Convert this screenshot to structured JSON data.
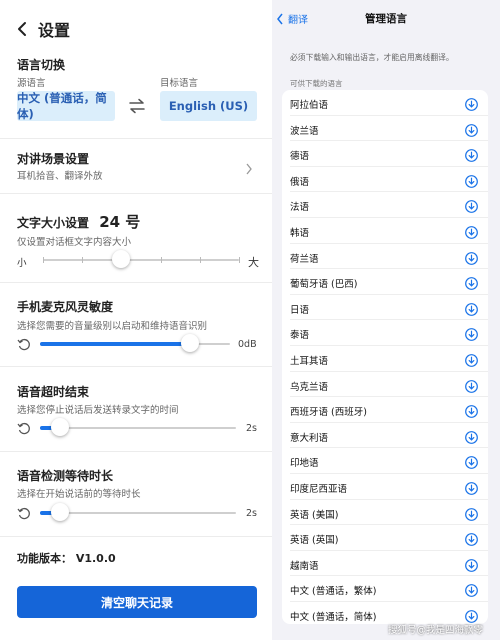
{
  "left": {
    "title": "设置",
    "lang_switch": {
      "title": "语言切换",
      "source_label": "源语言",
      "target_label": "目标语言",
      "source_value": "中文 (普通话，简体)",
      "target_value": "English (US)"
    },
    "scene": {
      "title": "对讲场景设置",
      "subtitle": "耳机拾音、翻译外放"
    },
    "text_size": {
      "title": "文字大小设置",
      "value": "24 号",
      "subtitle": "仅设置对话框文字内容大小",
      "min_label": "小",
      "max_label": "大",
      "level": 0.4
    },
    "mic": {
      "title": "手机麦克风灵敏度",
      "subtitle": "选择您需要的音量级别以启动和维持语音识别",
      "value": "0dB",
      "level": 0.79
    },
    "timeout": {
      "title": "语音超时结束",
      "subtitle": "选择您停止说话后发送转录文字的时间",
      "value": "2s",
      "level": 0.1
    },
    "wait": {
      "title": "语音检测等待时长",
      "subtitle": "选择在开始说话前的等待时长",
      "value": "2s",
      "level": 0.1
    },
    "version": "功能版本： V1.0.0",
    "clear_button": "清空聊天记录"
  },
  "right": {
    "back_label": "翻译",
    "title": "管理语言",
    "note": "必须下载输入和输出语言，才能启用离线翻译。",
    "section": "可供下载的语言",
    "languages": [
      "阿拉伯语",
      "波兰语",
      "德语",
      "俄语",
      "法语",
      "韩语",
      "荷兰语",
      "葡萄牙语 (巴西)",
      "日语",
      "泰语",
      "土耳其语",
      "乌克兰语",
      "西班牙语 (西班牙)",
      "意大利语",
      "印地语",
      "印度尼西亚语",
      "英语 (美国)",
      "英语 (英国)",
      "越南语",
      "中文 (普通话，繁体)",
      "中文 (普通话，简体)"
    ]
  },
  "watermark": "搜狐号@我是四海飘零",
  "colors": {
    "accent": "#1a73e8",
    "button": "#1565d8",
    "lang_box_bg": "#dbeefb"
  },
  "icons": {
    "back": "chevron-left-icon",
    "swap": "swap-arrows-icon",
    "chevron": "chevron-right-icon",
    "reset": "reset-icon",
    "download": "download-icon"
  }
}
